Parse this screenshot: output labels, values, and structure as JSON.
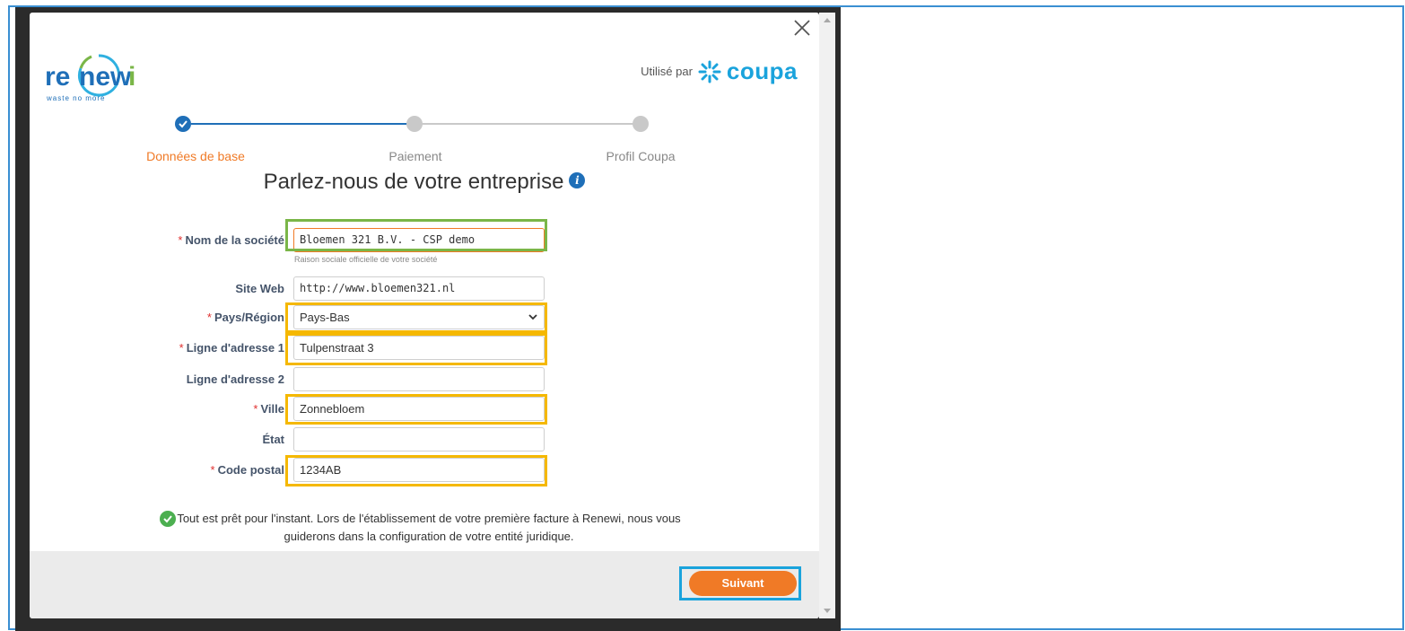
{
  "header": {
    "logo_text": "renewi",
    "logo_tagline": "waste no more",
    "powered_label": "Utilisé par",
    "powered_brand": "coupa"
  },
  "stepper": {
    "steps": [
      {
        "label": "Données de base",
        "state": "done"
      },
      {
        "label": "Paiement",
        "state": "pending"
      },
      {
        "label": "Profil Coupa",
        "state": "pending"
      }
    ]
  },
  "form": {
    "title": "Parlez-nous de votre entreprise",
    "required_mark": "*",
    "company_name": {
      "label": "Nom de la société",
      "value": "Bloemen 321 B.V. - CSP demo",
      "hint": "Raison sociale officielle de votre société"
    },
    "website": {
      "label": "Site Web",
      "value": "http://www.bloemen321.nl"
    },
    "country": {
      "label": "Pays/Région",
      "value": "Pays-Bas"
    },
    "address1": {
      "label": "Ligne d'adresse 1",
      "value": "Tulpenstraat 3"
    },
    "address2": {
      "label": "Ligne d'adresse 2",
      "value": ""
    },
    "city": {
      "label": "Ville",
      "value": "Zonnebloem"
    },
    "state": {
      "label": "État",
      "value": ""
    },
    "postal_code": {
      "label": "Code postal",
      "value": "1234AB"
    }
  },
  "notice": {
    "line1": "Tout est prêt pour l'instant. Lors de l'établissement de votre première facture à Renewi, nous vous",
    "line2": "guiderons dans la configuration de votre entité juridique."
  },
  "footer": {
    "next_label": "Suivant"
  },
  "colors": {
    "accent": "#f07a26",
    "step_done": "#1f6fb8",
    "highlight_green": "#7ab648",
    "highlight_yellow": "#f5b800",
    "highlight_blue": "#1aa3dc",
    "brand_coupa": "#1aa3dc"
  }
}
